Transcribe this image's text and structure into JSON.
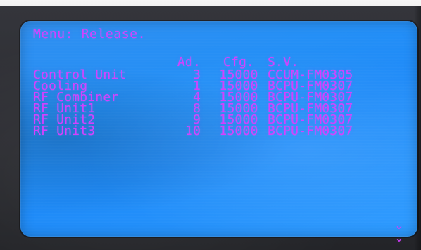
{
  "screen": {
    "title": "Menu: Release.",
    "table": {
      "headers": {
        "ad": "Ad.",
        "cfg": "Cfg.",
        "sv": "S.V."
      },
      "rows": [
        {
          "name": "Control Unit",
          "ad": "3",
          "cfg": "15000",
          "sv": "CCUM-FM0305"
        },
        {
          "name": "Cooling",
          "ad": "1",
          "cfg": "15000",
          "sv": "BCPU-FM0307"
        },
        {
          "name": "RF Combiner",
          "ad": "4",
          "cfg": "15000",
          "sv": "BCPU-FM0307"
        },
        {
          "name": "RF Unit1",
          "ad": "8",
          "cfg": "15000",
          "sv": "BCPU-FM0307"
        },
        {
          "name": "RF Unit2",
          "ad": "9",
          "cfg": "15000",
          "sv": "BCPU-FM0307"
        },
        {
          "name": "RF Unit3",
          "ad": "10",
          "cfg": "15000",
          "sv": "BCPU-FM0307"
        }
      ]
    },
    "scroll_indicator_icon": "double-chevron-down-icon"
  },
  "colors": {
    "lcd_background": "#1f8bf8",
    "lcd_text": "#d53cff",
    "bezel": "#2c2d32"
  }
}
